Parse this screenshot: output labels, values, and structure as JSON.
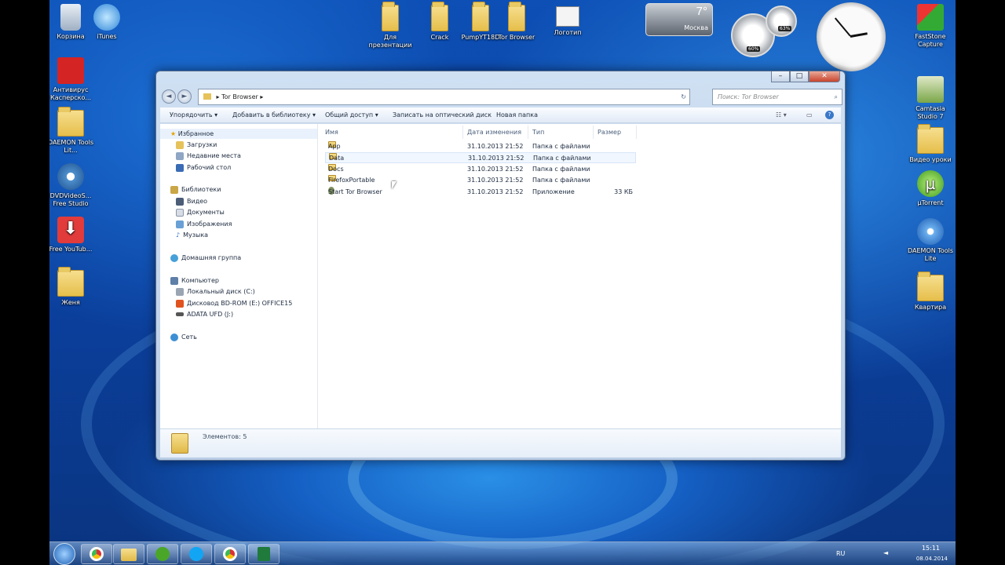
{
  "desktop_left": [
    {
      "label": "Корзина"
    },
    {
      "label": "iTunes"
    },
    {
      "label": "Антивирус Касперско..."
    },
    {
      "label": "DAEMON Tools Lit..."
    },
    {
      "label": "DVDVideoS... Free Studio"
    },
    {
      "label": "Free YouTub..."
    },
    {
      "label": "Женя"
    }
  ],
  "desktop_top": [
    {
      "label": "Для презентации"
    },
    {
      "label": "Crack"
    },
    {
      "label": "PumpYT18D"
    },
    {
      "label": "Tor Browser"
    },
    {
      "label": "Логотип"
    }
  ],
  "desktop_right": [
    {
      "label": "FastStone Capture"
    },
    {
      "label": "Camtasia Studio 7"
    },
    {
      "label": "Видео уроки"
    },
    {
      "label": "µTorrent"
    },
    {
      "label": "DAEMON Tools Lite"
    },
    {
      "label": "Квартира"
    }
  ],
  "weather": {
    "temp": "7°",
    "city": "Москва"
  },
  "meter": {
    "cpu": "60%",
    "ram": "63%"
  },
  "window": {
    "address": "Tor Browser",
    "search_placeholder": "Поиск: Tor Browser",
    "toolbar": {
      "organize": "Упорядочить ▾",
      "library": "Добавить в библиотеку ▾",
      "share": "Общий доступ ▾",
      "burn": "Записать на оптический диск",
      "new_folder": "Новая папка"
    },
    "nav": {
      "favorites": "Избранное",
      "downloads": "Загрузки",
      "recent": "Недавние места",
      "desktop": "Рабочий стол",
      "libraries": "Библиотеки",
      "video": "Видео",
      "documents": "Документы",
      "pictures": "Изображения",
      "music": "Музыка",
      "homegroup": "Домашняя группа",
      "computer": "Компьютер",
      "disk_c": "Локальный диск (C:)",
      "disk_e": "Дисковод BD-ROM (E:) OFFICE15",
      "disk_j": "ADATA UFD (J:)",
      "network": "Сеть"
    },
    "columns": {
      "name": "Имя",
      "date": "Дата изменения",
      "type": "Тип",
      "size": "Размер"
    },
    "files": [
      {
        "name": "App",
        "date": "31.10.2013 21:52",
        "type": "Папка с файлами",
        "size": ""
      },
      {
        "name": "Data",
        "date": "31.10.2013 21:52",
        "type": "Папка с файлами",
        "size": ""
      },
      {
        "name": "Docs",
        "date": "31.10.2013 21:52",
        "type": "Папка с файлами",
        "size": ""
      },
      {
        "name": "FirefoxPortable",
        "date": "31.10.2013 21:52",
        "type": "Папка с файлами",
        "size": ""
      },
      {
        "name": "Start Tor Browser",
        "date": "31.10.2013 21:52",
        "type": "Приложение",
        "size": "33 КБ"
      }
    ],
    "status": "Элементов: 5"
  },
  "tray": {
    "lang": "RU",
    "time": "15:11",
    "date": "08.04.2014"
  },
  "colors": {
    "accent": "#1560c4",
    "selection": "#f1f7fe"
  }
}
